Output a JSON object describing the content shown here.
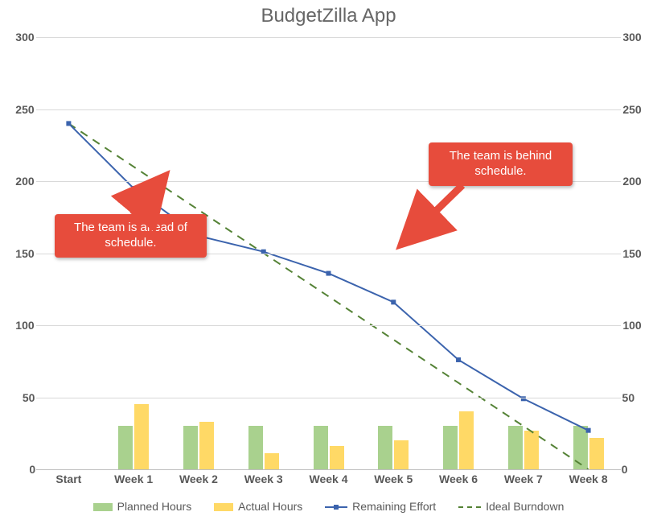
{
  "chart_data": {
    "type": "bar+line",
    "title": "BudgetZilla App",
    "categories": [
      "Start",
      "Week 1",
      "Week 2",
      "Week 3",
      "Week 4",
      "Week 5",
      "Week 6",
      "Week 7",
      "Week 8"
    ],
    "ylim": [
      0,
      300
    ],
    "ytick_step": 50,
    "series": [
      {
        "name": "Planned Hours",
        "kind": "bar",
        "color": "#a9d18e",
        "values": [
          null,
          30,
          30,
          30,
          30,
          30,
          30,
          30,
          30
        ]
      },
      {
        "name": "Actual Hours",
        "kind": "bar",
        "color": "#ffd966",
        "values": [
          null,
          45,
          33,
          11,
          16,
          20,
          40,
          27,
          22
        ]
      },
      {
        "name": "Remaining Effort",
        "kind": "line",
        "color": "#3b63ad",
        "values": [
          240,
          195,
          162,
          151,
          136,
          116,
          76,
          49,
          27
        ]
      },
      {
        "name": "Ideal Burndown",
        "kind": "dash",
        "color": "#548235",
        "values": [
          240,
          210,
          180,
          150,
          120,
          90,
          60,
          30,
          0
        ]
      }
    ],
    "annotations": [
      {
        "text": "The team is ahead of schedule.",
        "target_index": 1,
        "side": "below"
      },
      {
        "text": "The team is behind schedule.",
        "target_index": 5,
        "side": "above"
      }
    ],
    "legend": [
      "Planned Hours",
      "Actual Hours",
      "Remaining Effort",
      "Ideal Burndown"
    ]
  }
}
